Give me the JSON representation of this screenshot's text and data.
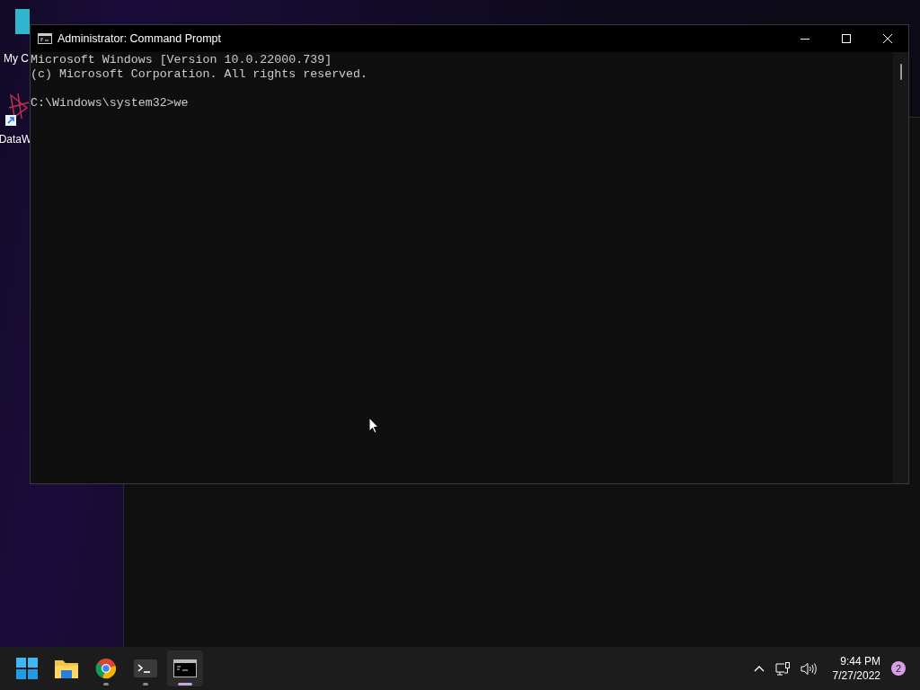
{
  "desktop_icons": [
    {
      "label": "My C",
      "kind": "monitor"
    },
    {
      "label": "DataW",
      "kind": "shortcut"
    }
  ],
  "window": {
    "title": "Administrator: Command Prompt",
    "output": [
      "Microsoft Windows [Version 10.0.22000.739]",
      "(c) Microsoft Corporation. All rights reserved."
    ],
    "prompt": "C:\\Windows\\system32>we"
  },
  "taskbar": {
    "apps": [
      {
        "kind": "start",
        "running": false,
        "selected": false
      },
      {
        "kind": "folder",
        "running": false,
        "selected": false
      },
      {
        "kind": "browser",
        "running": true,
        "selected": false
      },
      {
        "kind": "terminal",
        "running": true,
        "selected": false
      },
      {
        "kind": "console",
        "running": true,
        "selected": true
      }
    ],
    "time": "9:44 PM",
    "date": "7/27/2022",
    "notification_count": "2"
  }
}
